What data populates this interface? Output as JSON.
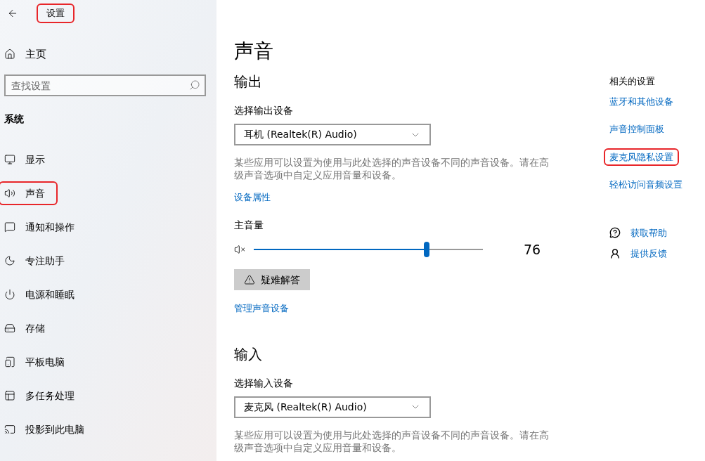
{
  "header": {
    "title": "设置",
    "title_highlighted": true
  },
  "sidebar": {
    "home": "主页",
    "search": {
      "placeholder": "查找设置"
    },
    "section": "系统",
    "items": [
      {
        "label": "显示",
        "highlighted": false
      },
      {
        "label": "声音",
        "highlighted": true
      },
      {
        "label": "通知和操作",
        "highlighted": false
      },
      {
        "label": "专注助手",
        "highlighted": false
      },
      {
        "label": "电源和睡眠",
        "highlighted": false
      },
      {
        "label": "存储",
        "highlighted": false
      },
      {
        "label": "平板电脑",
        "highlighted": false
      },
      {
        "label": "多任务处理",
        "highlighted": false
      },
      {
        "label": "投影到此电脑",
        "highlighted": false
      }
    ]
  },
  "page": {
    "title": "声音",
    "output": {
      "heading": "输出",
      "device_label": "选择输出设备",
      "device": "耳机 (Realtek(R) Audio)",
      "description": "某些应用可以设置为使用与此处选择的声音设备不同的声音设备。请在高级声音选项中自定义应用音量和设备。",
      "properties_link": "设备属性",
      "volume_label": "主音量",
      "volume": {
        "level": 0.755,
        "reading": "76"
      },
      "troubleshoot": "疑难解答",
      "manage_link": "管理声音设备"
    },
    "input": {
      "heading": "输入",
      "device_label": "选择输入设备",
      "device": "麦克风 (Realtek(R) Audio)",
      "description": "某些应用可以设置为使用与此处选择的声音设备不同的声音设备。请在高级声音选项中自定义应用音量和设备。"
    }
  },
  "related": {
    "heading": "相关的设置",
    "links": [
      {
        "label": "蓝牙和其他设备",
        "highlighted": false
      },
      {
        "label": "声音控制面板",
        "highlighted": false
      },
      {
        "label": "麦克风隐私设置",
        "highlighted": true
      },
      {
        "label": "轻松访问音频设置",
        "highlighted": false
      }
    ],
    "help": [
      {
        "label": "获取帮助",
        "kind": "help"
      },
      {
        "label": "提供反馈",
        "kind": "feedback"
      }
    ]
  }
}
